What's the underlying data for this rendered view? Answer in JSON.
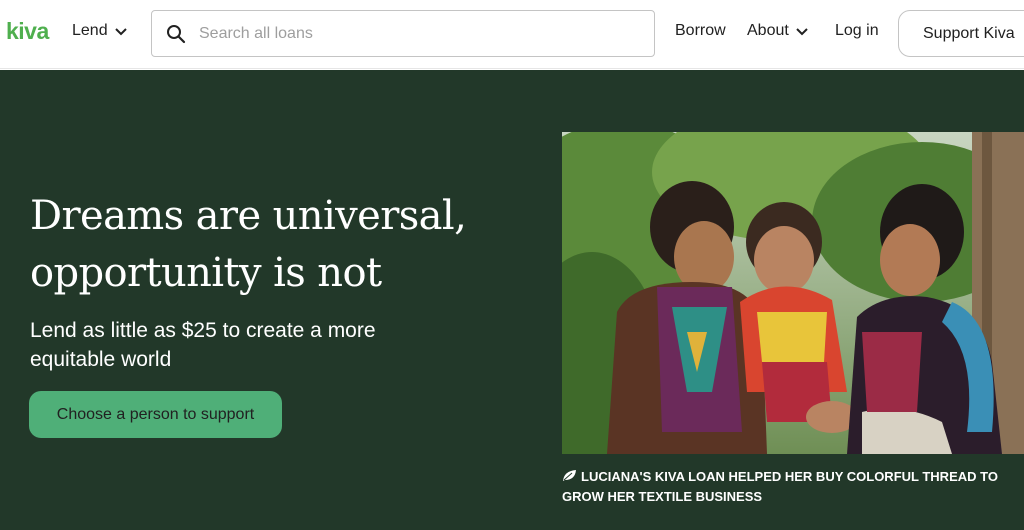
{
  "header": {
    "logo": "kiva",
    "lend_label": "Lend",
    "search_placeholder": "Search all loans",
    "borrow_label": "Borrow",
    "about_label": "About",
    "login_label": "Log in",
    "support_label": "Support Kiva"
  },
  "hero": {
    "headline": "Dreams are universal, opportunity is not",
    "subline": "Lend as little as $25 to create a more equitable world",
    "cta_label": "Choose a person to support",
    "caption": "Luciana's Kiva loan helped her buy colorful thread to grow her textile business"
  },
  "colors": {
    "brand_green": "#4faf4e",
    "hero_bg": "#223829",
    "cta_bg": "#4faf78"
  }
}
